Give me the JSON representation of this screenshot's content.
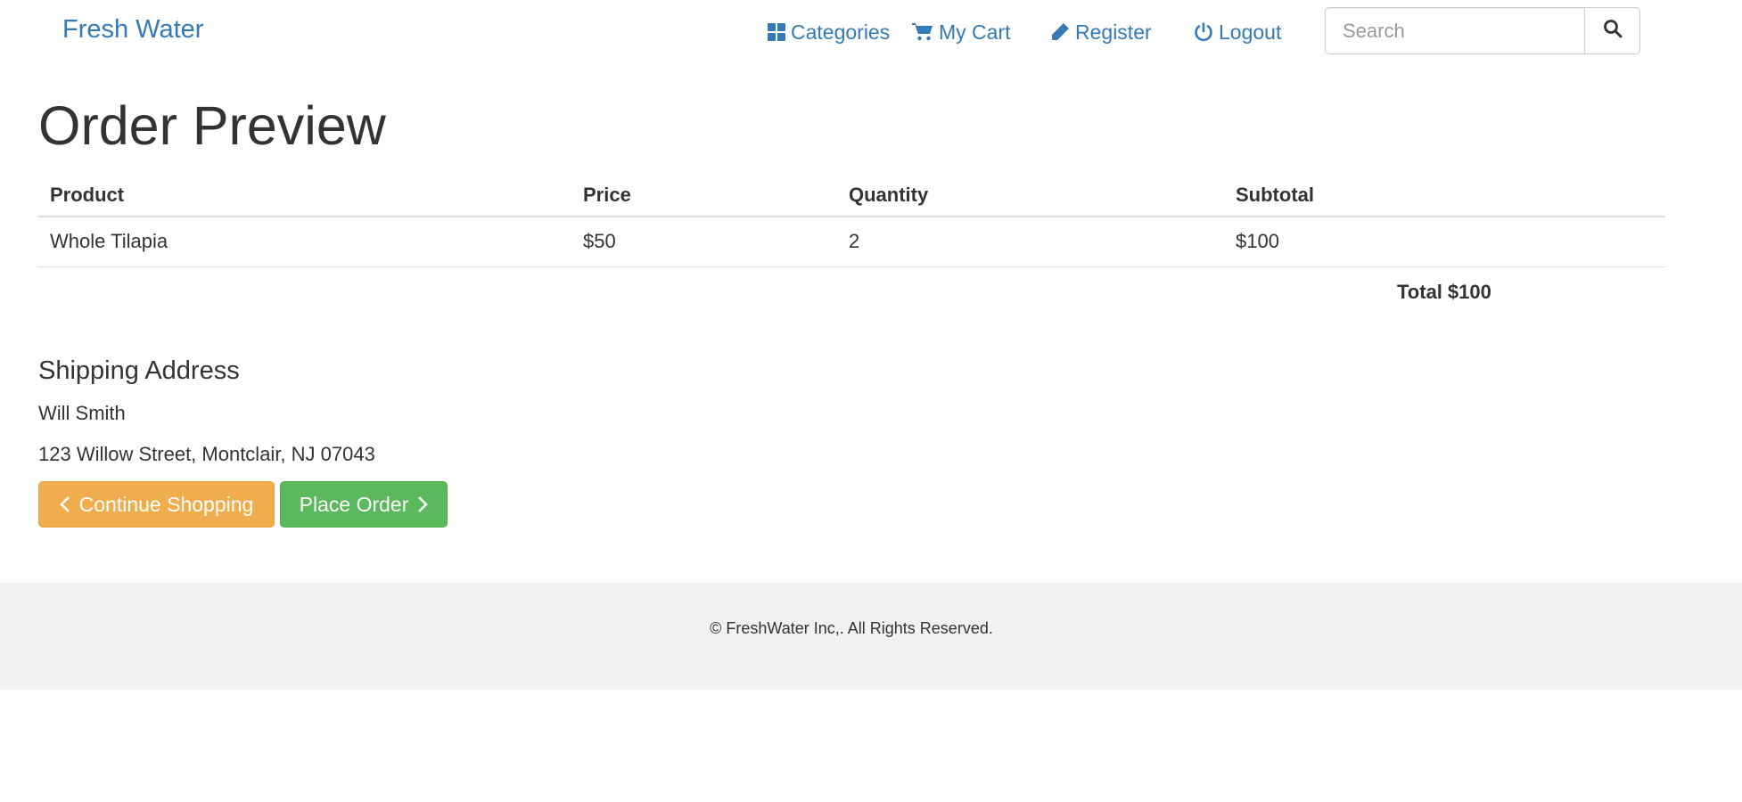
{
  "navbar": {
    "brand": "Fresh Water",
    "links": {
      "categories": "Categories",
      "cart": "My Cart",
      "register": "Register",
      "logout": "Logout"
    },
    "search": {
      "placeholder": "Search",
      "value": ""
    }
  },
  "main": {
    "title": "Order Preview",
    "table": {
      "headers": [
        "Product",
        "Price",
        "Quantity",
        "Subtotal"
      ],
      "rows": [
        [
          "Whole Tilapia",
          "$50",
          "2",
          "$100"
        ]
      ]
    },
    "total_label": "Total",
    "total_value": "$100",
    "shipping": {
      "heading": "Shipping Address",
      "name": "Will Smith",
      "address": "123 Willow Street, Montclair, NJ 07043"
    },
    "buttons": {
      "continue": "Continue Shopping",
      "place_order": "Place Order"
    }
  },
  "footer": {
    "text": "© FreshWater Inc,. All Rights Reserved."
  },
  "colors": {
    "link": "#337ab7",
    "warning": "#f0ad4e",
    "success": "#5cb85c",
    "footer_bg": "#f2f2f2"
  },
  "icons": [
    "th-large-icon",
    "shopping-cart-icon",
    "pencil-icon",
    "power-off-icon",
    "search-icon",
    "chevron-left-icon",
    "chevron-right-icon"
  ]
}
